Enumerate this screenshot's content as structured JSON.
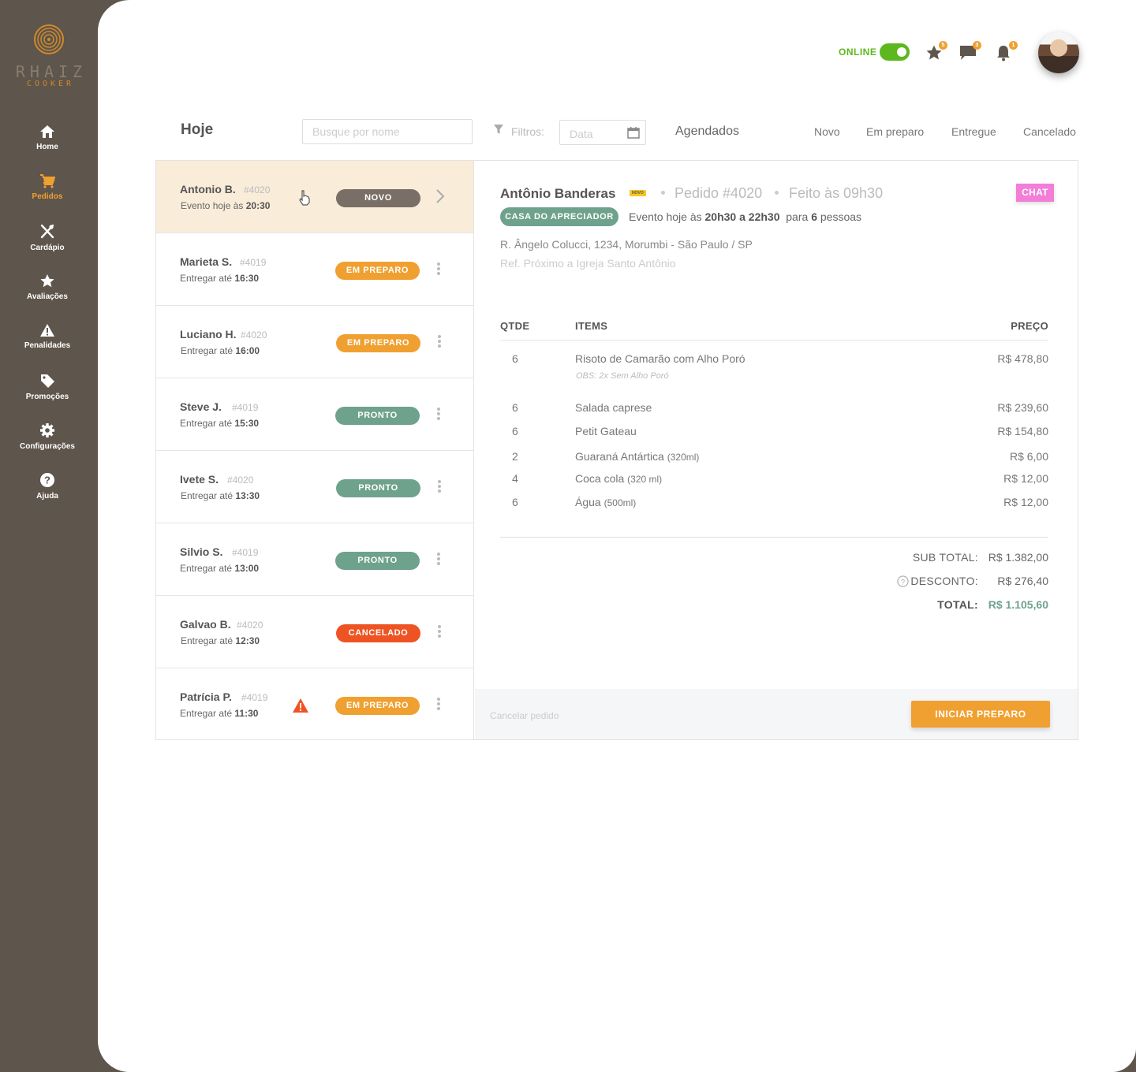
{
  "brand": {
    "name": "RHAIZ",
    "sub": "COOKER"
  },
  "colors": {
    "sidebar": "#5e554c",
    "accent": "#f0a030",
    "green": "#6fa28c",
    "online": "#5cb81e",
    "danger": "#ee5423",
    "chat": "#f27ed8"
  },
  "sidebar": {
    "items": [
      {
        "label": "Home",
        "icon": "home-icon",
        "active": false
      },
      {
        "label": "Pedidos",
        "icon": "cart-icon",
        "active": true
      },
      {
        "label": "Cardápio",
        "icon": "utensils-icon",
        "active": false
      },
      {
        "label": "Avaliações",
        "icon": "star-icon",
        "active": false
      },
      {
        "label": "Penalidades",
        "icon": "warning-icon",
        "active": false
      },
      {
        "label": "Promoções",
        "icon": "tag-icon",
        "active": false
      },
      {
        "label": "Configurações",
        "icon": "gear-icon",
        "active": false
      },
      {
        "label": "Ajuda",
        "icon": "help-icon",
        "active": false
      }
    ]
  },
  "topbar": {
    "online_label": "ONLINE",
    "online": true,
    "badges": {
      "reviews": "5",
      "messages": "3",
      "notifications": "1"
    }
  },
  "filters": {
    "title": "Hoje",
    "search_placeholder": "Busque por nome",
    "filter_label": "Filtros:",
    "date_placeholder": "Data",
    "scheduled": "Agendados",
    "statuses": [
      "Novo",
      "Em preparo",
      "Entregue",
      "Cancelado"
    ]
  },
  "orders": [
    {
      "name": "Antonio B.",
      "id": "#4020",
      "when_prefix": "Evento hoje às",
      "time": "20:30",
      "status": "NOVO",
      "status_color": "#7a6f66",
      "selected": true
    },
    {
      "name": "Marieta S.",
      "id": "#4019",
      "when_prefix": "Entregar até",
      "time": "16:30",
      "status": "EM PREPARO",
      "status_color": "#f0a030"
    },
    {
      "name": "Luciano H.",
      "id": "#4020",
      "when_prefix": "Entregar até",
      "time": "16:00",
      "status": "EM PREPARO",
      "status_color": "#f0a030"
    },
    {
      "name": "Steve J.",
      "id": "#4019",
      "when_prefix": "Entregar até",
      "time": "15:30",
      "status": "PRONTO",
      "status_color": "#6fa28c"
    },
    {
      "name": "Ivete S.",
      "id": "#4020",
      "when_prefix": "Entregar até",
      "time": "13:30",
      "status": "PRONTO",
      "status_color": "#6fa28c"
    },
    {
      "name": "Silvio S.",
      "id": "#4019",
      "when_prefix": "Entregar até",
      "time": "13:00",
      "status": "PRONTO",
      "status_color": "#6fa28c"
    },
    {
      "name": "Galvao B.",
      "id": "#4020",
      "when_prefix": "Entregar até",
      "time": "12:30",
      "status": "CANCELADO",
      "status_color": "#ee5423"
    },
    {
      "name": "Patrícia P.",
      "id": "#4019",
      "when_prefix": "Entregar até",
      "time": "11:30",
      "status": "EM PREPARO",
      "status_color": "#f0a030",
      "warning": true
    }
  ],
  "detail": {
    "customer": "Antônio Banderas",
    "tag": "NOVO",
    "order_label": "Pedido #4020",
    "placed_at": "Feito às 09h30",
    "chat": "CHAT",
    "venue": "CASA DO APRECIADOR",
    "event": {
      "prefix": "Evento hoje às",
      "range": "20h30 a 22h30",
      "middle": "para",
      "people": "6",
      "suffix": "pessoas"
    },
    "address": "R. Ângelo Colucci, 1234, Morumbi - São Paulo / SP",
    "reference": "Ref. Próximo a Igreja Santo Antônio",
    "headers": {
      "qty": "QTDE",
      "items": "ITEMS",
      "price": "PREÇO"
    },
    "items": [
      {
        "qty": "6",
        "name": "Risoto de Camarão com Alho Poró",
        "size": "",
        "price": "R$ 478,80",
        "obs": "OBS: 2x Sem Alho Poró"
      },
      {
        "qty": "6",
        "name": "Salada caprese",
        "size": "",
        "price": "R$ 239,60"
      },
      {
        "qty": "6",
        "name": "Petit Gateau",
        "size": "",
        "price": "R$ 154,80"
      },
      {
        "qty": "2",
        "name": "Guaraná Antártica",
        "size": "(320ml)",
        "price": "R$ 6,00"
      },
      {
        "qty": "4",
        "name": "Coca cola",
        "size": "(320 ml)",
        "price": "R$ 12,00"
      },
      {
        "qty": "6",
        "name": "Água",
        "size": "(500ml)",
        "price": "R$ 12,00"
      }
    ],
    "summary": {
      "subtotal_label": "SUB TOTAL:",
      "subtotal": "R$ 1.382,00",
      "discount_label": "DESCONTO:",
      "discount": "R$ 276,40",
      "total_label": "TOTAL:",
      "total": "R$ 1.105,60"
    },
    "cancel_label": "Cancelar pedido",
    "start_label": "INICIAR PREPARO"
  }
}
